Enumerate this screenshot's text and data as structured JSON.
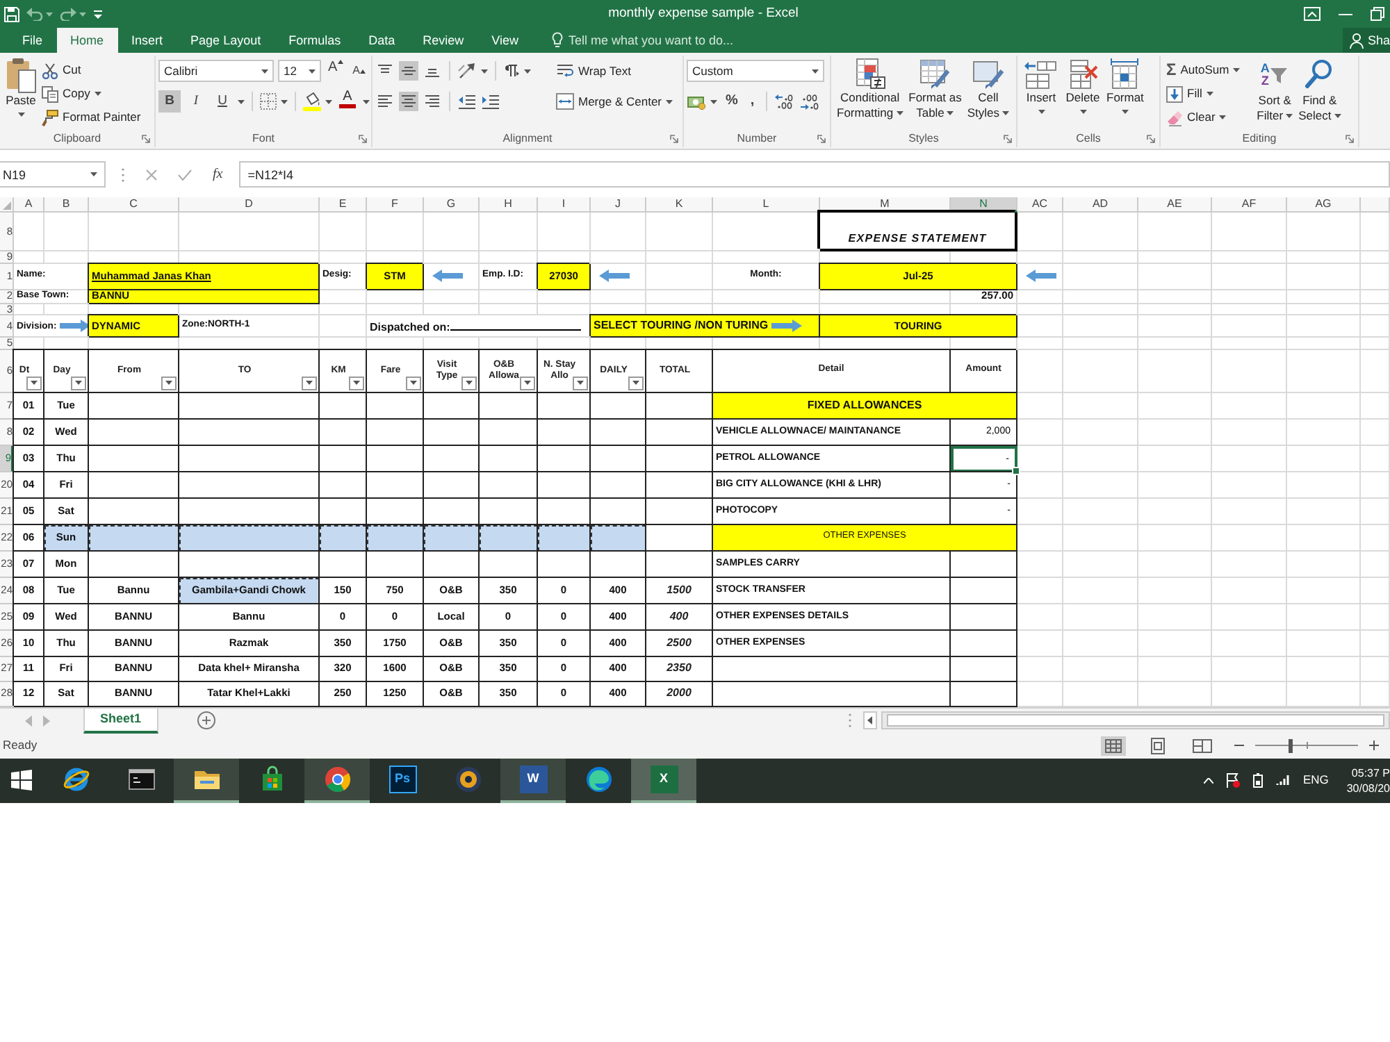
{
  "title_bar": {
    "title": "monthly expense sample - Excel"
  },
  "ribbon_tabs": [
    {
      "label": "File",
      "selected": false
    },
    {
      "label": "Home",
      "selected": true
    },
    {
      "label": "Insert",
      "selected": false
    },
    {
      "label": "Page Layout",
      "selected": false
    },
    {
      "label": "Formulas",
      "selected": false
    },
    {
      "label": "Data",
      "selected": false
    },
    {
      "label": "Review",
      "selected": false
    },
    {
      "label": "View",
      "selected": false
    }
  ],
  "tell_me": {
    "placeholder": "Tell me what you want to do..."
  },
  "share": {
    "label": "Sha"
  },
  "ribbon": {
    "clipboard": {
      "label": "Clipboard",
      "paste": "Paste",
      "cut": "Cut",
      "copy": "Copy",
      "format_painter": "Format Painter"
    },
    "font": {
      "label": "Font",
      "font_name": "Calibri",
      "font_size": "12",
      "grow": "A",
      "shrink": "A",
      "styles": [
        {
          "glyph": "B",
          "on": true
        },
        {
          "glyph": "I",
          "on": false
        },
        {
          "glyph": "U",
          "on": false
        }
      ],
      "font_color": "A"
    },
    "alignment": {
      "label": "Alignment",
      "vertical": [
        {
          "selected": false
        },
        {
          "selected": true
        },
        {
          "selected": false
        }
      ],
      "horizontal": [
        {
          "selected": false
        },
        {
          "selected": true
        },
        {
          "selected": false
        }
      ],
      "wrap_text": "Wrap Text",
      "merge": "Merge & Center"
    },
    "number": {
      "label": "Number",
      "format": "Custom",
      "percent": "%",
      "comma": ","
    },
    "styles": {
      "label": "Styles",
      "buttons": [
        {
          "lines": [
            "Conditional",
            "Formatting"
          ]
        },
        {
          "lines": [
            "Format as",
            "Table"
          ]
        },
        {
          "lines": [
            "Cell",
            "Styles"
          ]
        }
      ]
    },
    "cells": {
      "label": "Cells",
      "buttons": [
        "Insert",
        "Delete",
        "Format"
      ]
    },
    "editing": {
      "label": "Editing",
      "autosum_symbol": "Σ",
      "autosum": "AutoSum",
      "fill": "Fill",
      "clear": "Clear",
      "sort_letters": [
        "A",
        "Z"
      ],
      "sort": [
        "Sort &",
        "Filter"
      ],
      "find": [
        "Find &",
        "Select"
      ]
    }
  },
  "formula_bar": {
    "name_box": "N19",
    "function_label": "fx",
    "formula": "=N12*I4"
  },
  "columns": [
    {
      "label": "A",
      "selected": false
    },
    {
      "label": "B",
      "selected": false
    },
    {
      "label": "C",
      "selected": false
    },
    {
      "label": "D",
      "selected": false
    },
    {
      "label": "E",
      "selected": false
    },
    {
      "label": "F",
      "selected": false
    },
    {
      "label": "G",
      "selected": false
    },
    {
      "label": "H",
      "selected": false
    },
    {
      "label": "I",
      "selected": false
    },
    {
      "label": "J",
      "selected": false
    },
    {
      "label": "K",
      "selected": false
    },
    {
      "label": "L",
      "selected": false
    },
    {
      "label": "M",
      "selected": false
    },
    {
      "label": "N",
      "selected": true
    },
    {
      "label": "AC",
      "selected": false
    },
    {
      "label": "AD",
      "selected": false
    },
    {
      "label": "AE",
      "selected": false
    },
    {
      "label": "AF",
      "selected": false
    },
    {
      "label": "AG",
      "selected": false
    }
  ],
  "row_headers": [
    {
      "label": "8",
      "selected": false
    },
    {
      "label": "9",
      "selected": false
    },
    {
      "label": "1",
      "selected": false
    },
    {
      "label": "2",
      "selected": false
    },
    {
      "label": "3",
      "selected": false
    },
    {
      "label": "4",
      "selected": false
    },
    {
      "label": "5",
      "selected": false
    },
    {
      "label": "6",
      "selected": false
    },
    {
      "label": "7",
      "selected": false
    },
    {
      "label": "8",
      "selected": false
    },
    {
      "label": "9",
      "selected": true
    },
    {
      "label": "20",
      "selected": false
    },
    {
      "label": "21",
      "selected": false
    },
    {
      "label": "22",
      "selected": false
    },
    {
      "label": "23",
      "selected": false
    },
    {
      "label": "24",
      "selected": false
    },
    {
      "label": "25",
      "selected": false
    },
    {
      "label": "26",
      "selected": false
    },
    {
      "label": "27",
      "selected": false
    },
    {
      "label": "28",
      "selected": false
    }
  ],
  "sheet": {
    "title": "EXPENSE STATEMENT",
    "name_label": "Name:",
    "name": "Muhammad Janas Khan",
    "designation_label": "Desig:",
    "designation": "STM",
    "employee_id_label": "Emp. I.D:",
    "employee_id": "27030",
    "month_label": "Month:",
    "month": "Jul-25",
    "base_town_label": "Base Town:",
    "base_town": "BANNU",
    "rate": "257.00",
    "division_label": "Division:",
    "division": "DYNAMIC",
    "zone": "Zone:NORTH-1",
    "dispatched_label": "Dispatched on:",
    "touring_label": "SELECT TOURING /NON TURING",
    "touring": "TOURING"
  },
  "log_table": {
    "columns": [
      {
        "lines": [
          "Dt"
        ],
        "filter": true
      },
      {
        "lines": [
          "Day"
        ],
        "filter": true
      },
      {
        "lines": [
          "From"
        ],
        "filter": true
      },
      {
        "lines": [
          "TO"
        ],
        "filter": true
      },
      {
        "lines": [
          "KM"
        ],
        "filter": true
      },
      {
        "lines": [
          "Fare"
        ],
        "filter": true
      },
      {
        "lines": [
          "Visit",
          "Type"
        ],
        "filter": true
      },
      {
        "lines": [
          "O&B",
          "Allowa"
        ],
        "filter": true
      },
      {
        "lines": [
          "N. Stay",
          "Allo"
        ],
        "filter": true
      },
      {
        "lines": [
          "DAILY"
        ],
        "filter": true
      },
      {
        "lines": [
          "TOTAL"
        ],
        "filter": false
      }
    ],
    "rows": [
      {
        "cells": [
          {
            "text": "01",
            "highlighted": false
          },
          {
            "text": "Tue",
            "highlighted": false
          },
          {
            "highlighted": false
          },
          {
            "highlighted": false
          },
          {
            "highlighted": false
          },
          {
            "highlighted": false
          },
          {
            "highlighted": false
          },
          {
            "highlighted": false
          },
          {
            "highlighted": false
          },
          {
            "highlighted": false
          },
          {
            "highlighted": false
          }
        ]
      },
      {
        "cells": [
          {
            "text": "02",
            "highlighted": false
          },
          {
            "text": "Wed",
            "highlighted": false
          },
          {
            "highlighted": false
          },
          {
            "highlighted": false
          },
          {
            "highlighted": false
          },
          {
            "highlighted": false
          },
          {
            "highlighted": false
          },
          {
            "highlighted": false
          },
          {
            "highlighted": false
          },
          {
            "highlighted": false
          },
          {
            "highlighted": false
          }
        ]
      },
      {
        "cells": [
          {
            "text": "03",
            "highlighted": false
          },
          {
            "text": "Thu",
            "highlighted": false
          },
          {
            "highlighted": false
          },
          {
            "highlighted": false
          },
          {
            "highlighted": false
          },
          {
            "highlighted": false
          },
          {
            "highlighted": false
          },
          {
            "highlighted": false
          },
          {
            "highlighted": false
          },
          {
            "highlighted": false
          },
          {
            "highlighted": false
          }
        ]
      },
      {
        "cells": [
          {
            "text": "04",
            "highlighted": false
          },
          {
            "text": "Fri",
            "highlighted": false
          },
          {
            "highlighted": false
          },
          {
            "highlighted": false
          },
          {
            "highlighted": false
          },
          {
            "highlighted": false
          },
          {
            "highlighted": false
          },
          {
            "highlighted": false
          },
          {
            "highlighted": false
          },
          {
            "highlighted": false
          },
          {
            "highlighted": false
          }
        ]
      },
      {
        "cells": [
          {
            "text": "05",
            "highlighted": false
          },
          {
            "text": "Sat",
            "highlighted": false
          },
          {
            "highlighted": false
          },
          {
            "highlighted": false
          },
          {
            "highlighted": false
          },
          {
            "highlighted": false
          },
          {
            "highlighted": false
          },
          {
            "highlighted": false
          },
          {
            "highlighted": false
          },
          {
            "highlighted": false
          },
          {
            "highlighted": false
          }
        ]
      },
      {
        "cells": [
          {
            "text": "06",
            "highlighted": false
          },
          {
            "text": "Sun",
            "highlighted": true
          },
          {
            "highlighted": true
          },
          {
            "highlighted": true
          },
          {
            "highlighted": true
          },
          {
            "highlighted": true
          },
          {
            "highlighted": true
          },
          {
            "highlighted": true
          },
          {
            "highlighted": true
          },
          {
            "highlighted": true
          },
          {
            "highlighted": false
          }
        ]
      },
      {
        "cells": [
          {
            "text": "07",
            "highlighted": false
          },
          {
            "text": "Mon",
            "highlighted": false
          },
          {
            "highlighted": false
          },
          {
            "highlighted": false
          },
          {
            "highlighted": false
          },
          {
            "highlighted": false
          },
          {
            "highlighted": false
          },
          {
            "highlighted": false
          },
          {
            "highlighted": false
          },
          {
            "highlighted": false
          },
          {
            "highlighted": false
          }
        ]
      },
      {
        "cells": [
          {
            "text": "08",
            "highlighted": false
          },
          {
            "text": "Tue",
            "highlighted": false
          },
          {
            "text": "Bannu",
            "highlighted": false
          },
          {
            "text": "Gambila+Gandi Chowk",
            "highlighted": true
          },
          {
            "text": "150",
            "highlighted": false
          },
          {
            "text": "750",
            "highlighted": false
          },
          {
            "text": "O&B",
            "highlighted": false
          },
          {
            "text": "350",
            "highlighted": false
          },
          {
            "text": "0",
            "highlighted": false
          },
          {
            "text": "400",
            "highlighted": false
          },
          {
            "text": "1500",
            "highlighted": false
          }
        ]
      },
      {
        "cells": [
          {
            "text": "09",
            "highlighted": false
          },
          {
            "text": "Wed",
            "highlighted": false
          },
          {
            "text": "BANNU",
            "highlighted": false
          },
          {
            "text": "Bannu",
            "highlighted": false
          },
          {
            "text": "0",
            "highlighted": false
          },
          {
            "text": "0",
            "highlighted": false
          },
          {
            "text": "Local",
            "highlighted": false
          },
          {
            "text": "0",
            "highlighted": false
          },
          {
            "text": "0",
            "highlighted": false
          },
          {
            "text": "400",
            "highlighted": false
          },
          {
            "text": "400",
            "highlighted": false
          }
        ]
      },
      {
        "cells": [
          {
            "text": "10",
            "highlighted": false
          },
          {
            "text": "Thu",
            "highlighted": false
          },
          {
            "text": "BANNU",
            "highlighted": false
          },
          {
            "text": "Razmak",
            "highlighted": false
          },
          {
            "text": "350",
            "highlighted": false
          },
          {
            "text": "1750",
            "highlighted": false
          },
          {
            "text": "O&B",
            "highlighted": false
          },
          {
            "text": "350",
            "highlighted": false
          },
          {
            "text": "0",
            "highlighted": false
          },
          {
            "text": "400",
            "highlighted": false
          },
          {
            "text": "2500",
            "highlighted": false
          }
        ]
      },
      {
        "cells": [
          {
            "text": "11",
            "highlighted": false
          },
          {
            "text": "Fri",
            "highlighted": false
          },
          {
            "text": "BANNU",
            "highlighted": false
          },
          {
            "text": "Data khel+ Miransha",
            "highlighted": false
          },
          {
            "text": "320",
            "highlighted": false
          },
          {
            "text": "1600",
            "highlighted": false
          },
          {
            "text": "O&B",
            "highlighted": false
          },
          {
            "text": "350",
            "highlighted": false
          },
          {
            "text": "0",
            "highlighted": false
          },
          {
            "text": "400",
            "highlighted": false
          },
          {
            "text": "2350",
            "highlighted": false
          }
        ]
      },
      {
        "cells": [
          {
            "text": "12",
            "highlighted": false
          },
          {
            "text": "Sat",
            "highlighted": false
          },
          {
            "text": "BANNU",
            "highlighted": false
          },
          {
            "text": "Tatar Khel+Lakki",
            "highlighted": false
          },
          {
            "text": "250",
            "highlighted": false
          },
          {
            "text": "1250",
            "highlighted": false
          },
          {
            "text": "O&B",
            "highlighted": false
          },
          {
            "text": "350",
            "highlighted": false
          },
          {
            "text": "0",
            "highlighted": false
          },
          {
            "text": "400",
            "highlighted": false
          },
          {
            "text": "2000",
            "highlighted": false
          }
        ]
      }
    ]
  },
  "detail": {
    "header": "Detail",
    "amount_header": "Amount",
    "rows": [
      {
        "kind": "section",
        "bold": true,
        "label": "FIXED ALLOWANCES",
        "selected": false
      },
      {
        "kind": "item",
        "label": "VEHICLE ALLOWNACE/ MAINTANANCE",
        "amount": "2,000",
        "selected": false
      },
      {
        "kind": "item",
        "label": "PETROL ALLOWANCE",
        "amount": "-",
        "selected": true
      },
      {
        "kind": "item",
        "label": "BIG CITY ALLOWANCE (KHI & LHR)",
        "amount": "-",
        "selected": false
      },
      {
        "kind": "item",
        "label": "PHOTOCOPY",
        "amount": "-",
        "selected": false
      },
      {
        "kind": "section",
        "bold": false,
        "label": "OTHER EXPENSES",
        "selected": false
      },
      {
        "kind": "item",
        "label": "SAMPLES CARRY",
        "selected": false
      },
      {
        "kind": "item",
        "label": "STOCK TRANSFER",
        "selected": false
      },
      {
        "kind": "item",
        "label": "OTHER EXPENSES DETAILS",
        "selected": false
      },
      {
        "kind": "item",
        "label": "OTHER EXPENSES",
        "selected": false
      },
      {
        "kind": "item",
        "selected": false
      },
      {
        "kind": "item",
        "selected": false
      }
    ]
  },
  "sheet_tabs": [
    {
      "label": "Sheet1",
      "selected": true
    }
  ],
  "status_bar": {
    "text": "Ready",
    "views": [
      {
        "selected": true
      },
      {
        "selected": false
      },
      {
        "selected": false
      }
    ],
    "zoom": {
      "level": 0.35
    }
  },
  "taskbar": {
    "apps": [
      {
        "open": false,
        "active": false
      },
      {
        "open": false,
        "active": false
      },
      {
        "open": true,
        "active": false
      },
      {
        "open": false,
        "active": false
      },
      {
        "open": true,
        "active": false
      },
      {
        "glyph": "Ps",
        "open": false,
        "active": false
      },
      {
        "open": false,
        "active": false
      },
      {
        "glyph": "W",
        "open": true,
        "active": false
      },
      {
        "open": false,
        "active": false
      },
      {
        "glyph": "X",
        "open": true,
        "active": true
      }
    ],
    "language": "ENG",
    "time": "05:37 P",
    "date": "30/08/20"
  }
}
